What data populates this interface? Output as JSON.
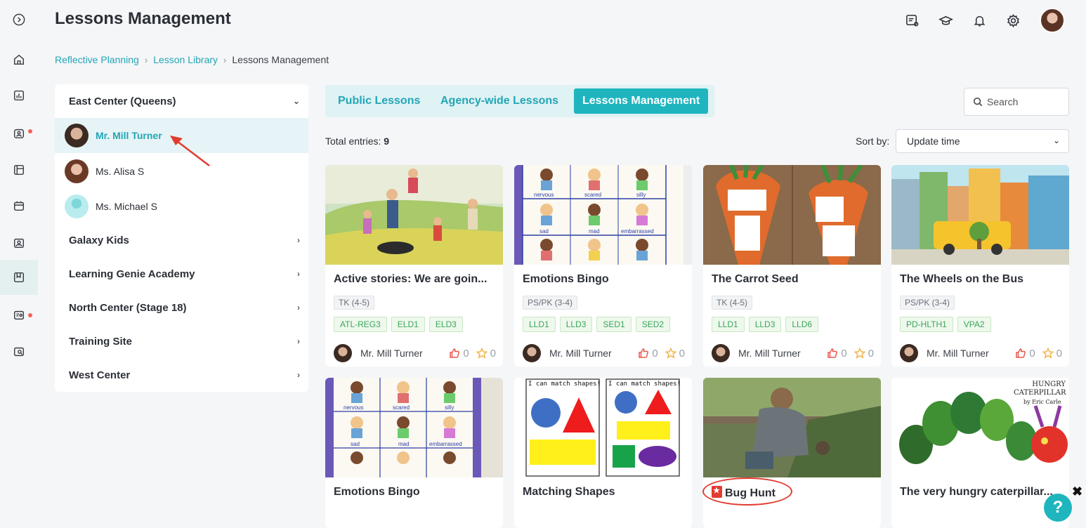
{
  "app": {
    "title": "Lessons Management"
  },
  "breadcrumb": [
    {
      "label": "Reflective Planning"
    },
    {
      "label": "Lesson Library"
    },
    {
      "label": "Lessons Management"
    }
  ],
  "sidebar_nav": [
    {
      "icon": "home-icon"
    },
    {
      "icon": "bar-chart-icon"
    },
    {
      "icon": "portfolio-icon",
      "has_notification": true
    },
    {
      "icon": "layout-icon"
    },
    {
      "icon": "calendar-icon"
    },
    {
      "icon": "photo-id-icon"
    },
    {
      "icon": "lesson-book-icon",
      "active": true
    },
    {
      "icon": "chat-list-icon",
      "has_notification": true
    },
    {
      "icon": "search-doc-icon"
    }
  ],
  "centers": {
    "expanded_center": "East Center (Queens)",
    "teachers": [
      {
        "name": "Mr. Mill Turner",
        "selected": true
      },
      {
        "name": "Ms. Alisa S",
        "selected": false
      },
      {
        "name": "Ms. Michael S",
        "selected": false
      }
    ],
    "collapsed_centers": [
      "Galaxy Kids",
      "Learning Genie Academy",
      "North Center (Stage 18)",
      "Training Site",
      "West Center"
    ]
  },
  "tabs": [
    {
      "label": "Public Lessons",
      "active": false
    },
    {
      "label": "Agency-wide Lessons",
      "active": false
    },
    {
      "label": "Lessons Management",
      "active": true
    }
  ],
  "search": {
    "placeholder": "Search"
  },
  "total": {
    "label": "Total entries:",
    "count": "9"
  },
  "sort": {
    "label": "Sort by:",
    "value": "Update time"
  },
  "cards": [
    {
      "title": "Active stories: We are goin...",
      "age": "TK (4-5)",
      "domains": [
        "ATL-REG3",
        "ELD1",
        "ELD3"
      ],
      "author": "Mr. Mill Turner",
      "likes": "0",
      "favorites": "0"
    },
    {
      "title": "Emotions Bingo",
      "age": "PS/PK (3-4)",
      "domains": [
        "LLD1",
        "LLD3",
        "SED1",
        "SED2"
      ],
      "author": "Mr. Mill Turner",
      "likes": "0",
      "favorites": "0"
    },
    {
      "title": "The Carrot Seed",
      "age": "TK (4-5)",
      "domains": [
        "LLD1",
        "LLD3",
        "LLD6"
      ],
      "author": "Mr. Mill Turner",
      "likes": "0",
      "favorites": "0"
    },
    {
      "title": "The Wheels on the Bus",
      "age": "PS/PK (3-4)",
      "domains": [
        "PD-HLTH1",
        "VPA2"
      ],
      "author": "Mr. Mill Turner",
      "likes": "0",
      "favorites": "0"
    },
    {
      "title": "Emotions Bingo"
    },
    {
      "title": "Matching Shapes"
    },
    {
      "title": "Bug Hunt"
    },
    {
      "title": "The very hungry caterpillar..."
    }
  ],
  "image_text": {
    "bingo_words": [
      "nervous",
      "scared",
      "silly",
      "sad",
      "mad",
      "embarrassed"
    ],
    "shapes_caption": "I can match shapes!",
    "caterpillar_title": "HUNGRY CATERPILLAR",
    "caterpillar_author": "by Eric Carle"
  },
  "help": {
    "label": "?",
    "close": "✖"
  },
  "colors": {
    "accent": "#1fb5bf",
    "link": "#23a6b6",
    "tag_green": "#3aa65a",
    "alert": "#e23b2f"
  }
}
